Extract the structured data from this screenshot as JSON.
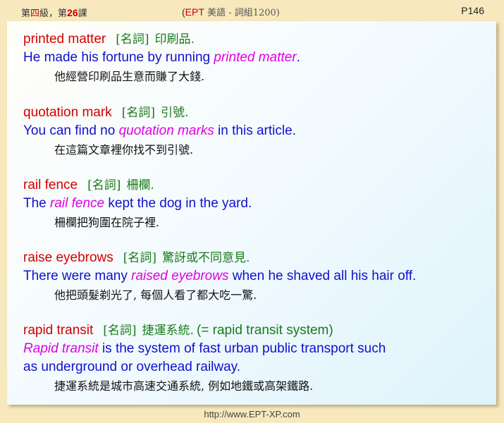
{
  "header": {
    "lesson_prefix": "第",
    "level": "四",
    "lesson_mid": "級，第",
    "lesson_num": "26",
    "lesson_suffix": "課",
    "center_open": "(",
    "center_ept": "EPT",
    "center_rest": " 美語 - 詞組1200)",
    "page": "P146"
  },
  "entries": [
    {
      "term": "printed matter",
      "pos": "[名詞]",
      "meaning": "印刷品.",
      "extra": "",
      "ex_pre": "He made his fortune by running ",
      "ex_hl": "printed matter",
      "ex_post": ".",
      "zh": "他經營印刷品生意而賺了大錢."
    },
    {
      "term": "quotation mark",
      "pos": "[名詞]",
      "meaning": "引號.",
      "extra": "",
      "ex_pre": "You can find no ",
      "ex_hl": "quotation marks",
      "ex_post": " in this article.",
      "zh": "在這篇文章裡你找不到引號."
    },
    {
      "term": "rail fence",
      "pos": "[名詞]",
      "meaning": "柵欄.",
      "extra": "",
      "ex_pre": "The ",
      "ex_hl": "rail fence",
      "ex_post": " kept the dog in the yard.",
      "zh": "柵欄把狗圍在院子裡."
    },
    {
      "term": "raise eyebrows",
      "pos": "[名詞]",
      "meaning": "驚訝或不同意見.",
      "extra": "",
      "ex_pre": "There were many ",
      "ex_hl": "raised eyebrows",
      "ex_post": " when he shaved all his hair off.",
      "zh": "他把頭髮剃光了, 每個人看了都大吃一驚."
    },
    {
      "term": "rapid transit",
      "pos": "[名詞]",
      "meaning": "捷運系統.",
      "extra": "(= rapid transit system)",
      "ex_pre": "",
      "ex_hl": "Rapid transit",
      "ex_post": " is the system of fast urban public transport such",
      "ex_line2": "as underground or overhead railway.",
      "zh": "捷運系統是城市高速交通系統, 例如地鐵或高架鐵路."
    }
  ],
  "footer": "http://www.EPT-XP.com"
}
